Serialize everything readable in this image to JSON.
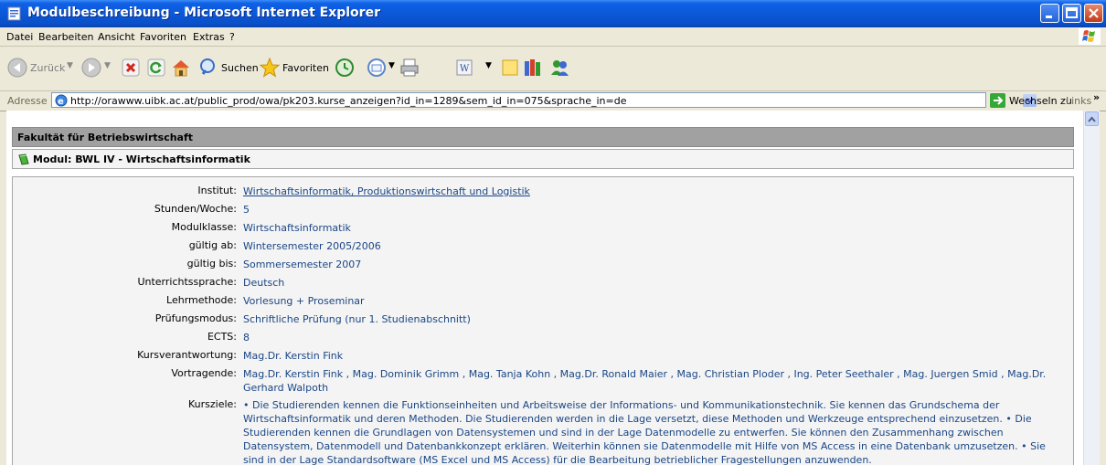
{
  "window": {
    "title": "Modulbeschreibung - Microsoft Internet Explorer"
  },
  "menu": [
    "Datei",
    "Bearbeiten",
    "Ansicht",
    "Favoriten",
    "Extras",
    "?"
  ],
  "toolbar": {
    "back_label": "Zurück",
    "search_label": "Suchen",
    "favorites_label": "Favoriten"
  },
  "address": {
    "label": "Adresse",
    "url": "http://orawww.uibk.ac.at/public_prod/owa/pk203.kurse_anzeigen?id_in=1289&sem_id_in=075&sprache_in=de",
    "go_label": "Wechseln zu",
    "links_label": "Links"
  },
  "page": {
    "faculty": "Fakultät für Betriebswirtschaft",
    "module": "Modul:  BWL IV - Wirtschaftsinformatik",
    "rows": [
      {
        "label": "Institut:",
        "value": "Wirtschaftsinformatik, Produktionswirtschaft und Logistik"
      },
      {
        "label": "Stunden/Woche:",
        "value": "5"
      },
      {
        "label": "Modulklasse:",
        "value": "Wirtschaftsinformatik"
      },
      {
        "label": "gültig ab:",
        "value": "Wintersemester 2005/2006"
      },
      {
        "label": "gültig bis:",
        "value": "Sommersemester 2007"
      },
      {
        "label": "Unterrichtssprache:",
        "value": "Deutsch"
      },
      {
        "label": "Lehrmethode:",
        "value": "Vorlesung + Proseminar"
      },
      {
        "label": "Prüfungsmodus:",
        "value": "Schriftliche Prüfung (nur 1. Studienabschnitt)"
      },
      {
        "label": "ECTS:",
        "value": "8"
      },
      {
        "label": "Kursverantwortung:",
        "value": "Mag.Dr. Kerstin Fink"
      },
      {
        "label": "Vortragende:",
        "value": "Mag.Dr. Kerstin Fink , Mag. Dominik Grimm , Mag. Tanja Kohn , Mag.Dr. Ronald Maier , Mag. Christian Ploder , Ing. Peter Seethaler , Mag. Juergen Smid , Mag.Dr. Gerhard Walpoth"
      },
      {
        "label": "Kursziele:",
        "value": "• Die Studierenden kennen die Funktionseinheiten und Arbeitsweise der Informations- und Kommunikationstechnik. Sie kennen das Grundschema der Wirtschaftsinformatik und deren Methoden. Die Studierenden werden in die Lage versetzt, diese Methoden und Werkzeuge entsprechend einzusetzen. • Die Studierenden kennen die Grundlagen von Datensystemen und sind in der Lage Datenmodelle zu entwerfen. Sie können den Zusammenhang zwischen Datensystem, Datenmodell und Datenbankkonzept erklären. Weiterhin können sie Datenmodelle mit Hilfe von MS Access in eine Datenbank umzusetzen. • Sie sind in der Lage Standardsoftware (MS Excel und MS Access) für die Bearbeitung betrieblicher Fragestellungen anzuwenden."
      }
    ]
  }
}
